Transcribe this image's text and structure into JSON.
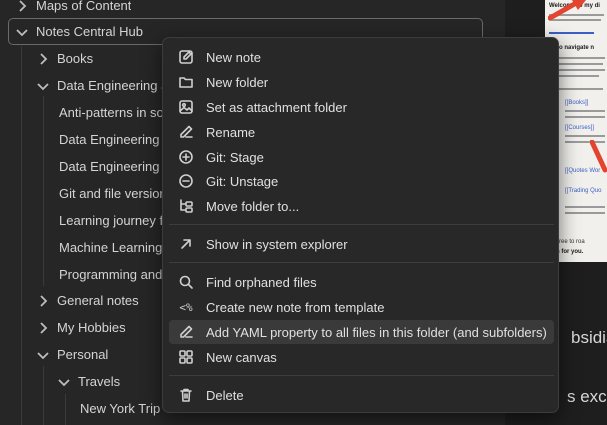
{
  "explorer": {
    "rows": [
      {
        "label": "Maps of Content",
        "chevron": "right"
      },
      {
        "label": "Notes Central Hub",
        "chevron": "down"
      },
      {
        "label": "Books",
        "chevron": "right"
      },
      {
        "label": "Data Engineering and",
        "chevron": "down"
      },
      {
        "label": "Anti-patterns in so",
        "chevron": ""
      },
      {
        "label": "Data Engineering",
        "chevron": ""
      },
      {
        "label": "Data Engineering",
        "chevron": ""
      },
      {
        "label": "Git and file version",
        "chevron": ""
      },
      {
        "label": "Learning journey f",
        "chevron": ""
      },
      {
        "label": "Machine Learning",
        "chevron": ""
      },
      {
        "label": "Programming and",
        "chevron": ""
      },
      {
        "label": "General notes",
        "chevron": "right"
      },
      {
        "label": "My Hobbies",
        "chevron": "right"
      },
      {
        "label": "Personal",
        "chevron": "down"
      },
      {
        "label": "Travels",
        "chevron": "down"
      },
      {
        "label": "New York Trip",
        "chevron": ""
      }
    ]
  },
  "context_menu": {
    "items": [
      {
        "label": "New note",
        "icon": "edit-note-icon"
      },
      {
        "label": "New folder",
        "icon": "folder-icon"
      },
      {
        "label": "Set as attachment folder",
        "icon": "image-icon"
      },
      {
        "label": "Rename",
        "icon": "pencil-icon"
      },
      {
        "label": "Git: Stage",
        "icon": "plus-circle-icon"
      },
      {
        "label": "Git: Unstage",
        "icon": "minus-circle-icon"
      },
      {
        "label": "Move folder to...",
        "icon": "folder-tree-icon"
      },
      {
        "label": "Show in system explorer",
        "icon": "arrow-up-right-icon"
      },
      {
        "label": "Find orphaned files",
        "icon": "search-icon"
      },
      {
        "label": "Create new note from template",
        "icon": "template-icon"
      },
      {
        "label": "Add YAML property to all files in this folder (and subfolders)",
        "icon": "pencil-icon"
      },
      {
        "label": "New canvas",
        "icon": "canvas-icon"
      },
      {
        "label": "Delete",
        "icon": "trash-icon"
      }
    ],
    "hovered_index": 10
  },
  "preview": {
    "heading": "Welcome to my di",
    "word_1": "bsidian",
    "word_2": "s exce",
    "link_1": "[[Books]]",
    "link_2": "[[Courses]]",
    "link_3": "[[Quotes Wor",
    "link_4": "[[Trading Quo",
    "howto": "ow to navigate n",
    "bottom_1": "are free to roa",
    "bottom_2": "itten for you.",
    "accent_color": "#e2442f"
  }
}
